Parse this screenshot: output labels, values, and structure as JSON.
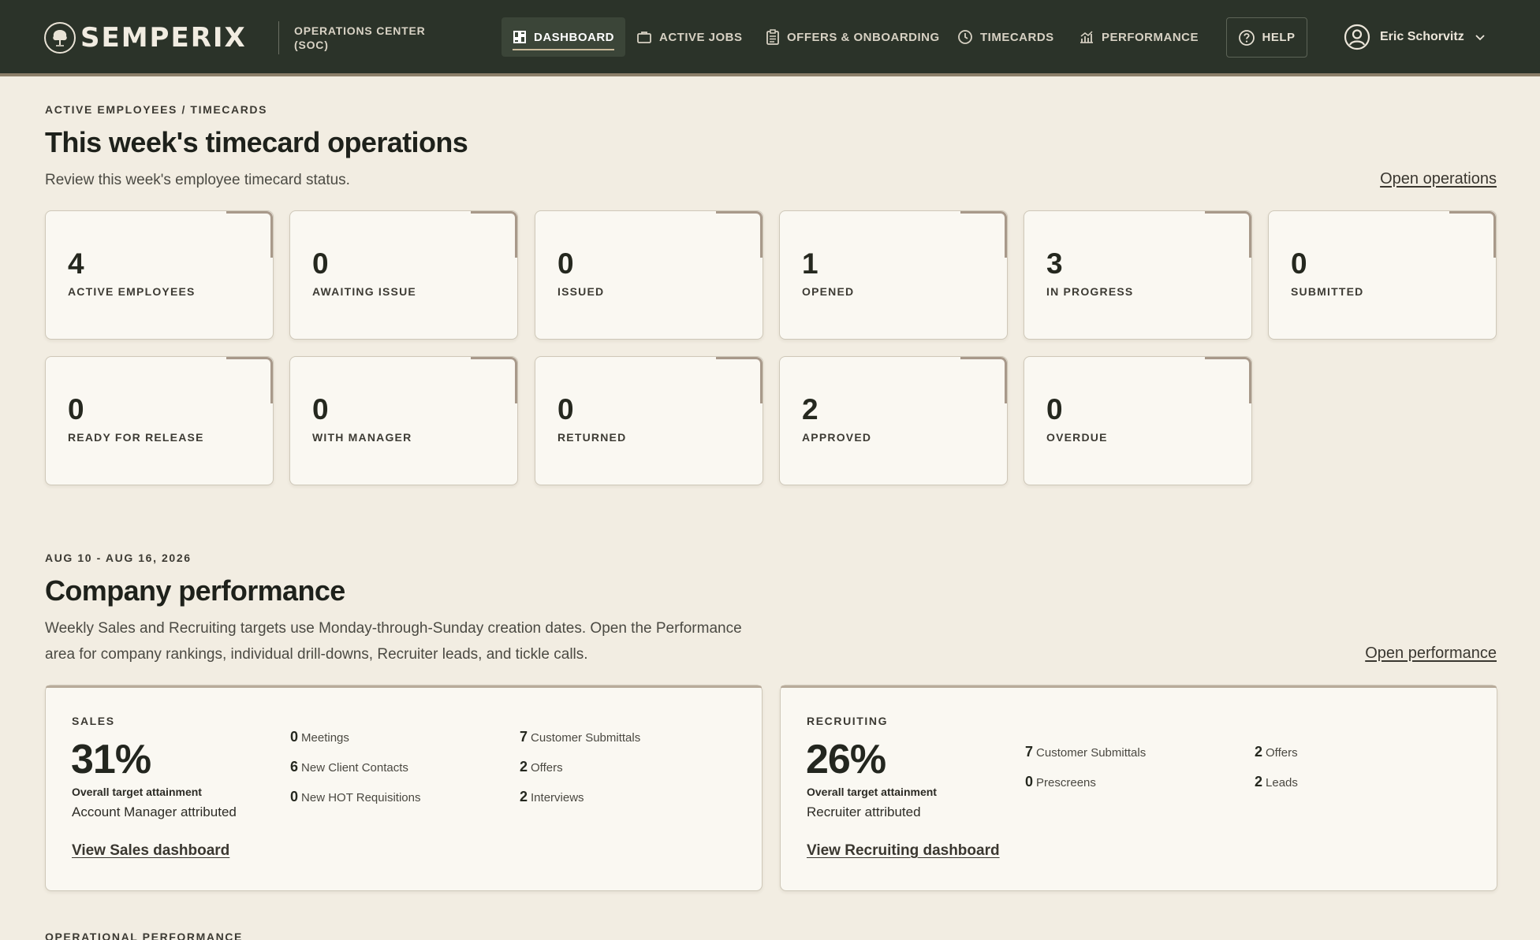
{
  "brand": {
    "name": "SEMPERIX",
    "subtitle": "OPERATIONS CENTER (SOC)",
    "logo_icon": "tree-seal-icon"
  },
  "nav": {
    "items": [
      {
        "label": "DASHBOARD",
        "icon": "grid-icon",
        "active": true
      },
      {
        "label": "ACTIVE JOBS",
        "icon": "briefcase-icon",
        "active": false
      },
      {
        "label": "OFFERS & ONBOARDING",
        "icon": "clipboard-icon",
        "active": false
      },
      {
        "label": "TIMECARDS",
        "icon": "clock-icon",
        "active": false
      },
      {
        "label": "PERFORMANCE",
        "icon": "chart-icon",
        "active": false
      }
    ],
    "help_label": "HELP",
    "user_name": "Eric Schorvitz"
  },
  "timecards": {
    "eyebrow": "ACTIVE EMPLOYEES / TIMECARDS",
    "title": "This week's timecard operations",
    "description": "Review this week's employee timecard status.",
    "link": "Open operations",
    "stats": [
      {
        "value": "4",
        "label": "ACTIVE EMPLOYEES"
      },
      {
        "value": "0",
        "label": "AWAITING ISSUE"
      },
      {
        "value": "0",
        "label": "ISSUED"
      },
      {
        "value": "1",
        "label": "OPENED"
      },
      {
        "value": "3",
        "label": "IN PROGRESS"
      },
      {
        "value": "0",
        "label": "SUBMITTED"
      },
      {
        "value": "0",
        "label": "READY FOR RELEASE"
      },
      {
        "value": "0",
        "label": "WITH MANAGER"
      },
      {
        "value": "0",
        "label": "RETURNED"
      },
      {
        "value": "2",
        "label": "APPROVED"
      },
      {
        "value": "0",
        "label": "OVERDUE"
      }
    ]
  },
  "performance": {
    "eyebrow": "AUG 10 - AUG 16, 2026",
    "title": "Company performance",
    "description_line1": "Weekly Sales and Recruiting targets use Monday-through-Sunday creation dates. Open the Performance",
    "description_line2": "area for company rankings, individual drill-downs, Recruiter leads, and tickle calls.",
    "link": "Open performance",
    "sales": {
      "eyebrow": "SALES",
      "pct": "31%",
      "pct_label": "Overall target attainment",
      "attribution": "Account Manager attributed",
      "metrics": [
        {
          "num": "0",
          "label": "Meetings"
        },
        {
          "num": "6",
          "label": "New Client Contacts"
        },
        {
          "num": "0",
          "label": "New HOT Requisitions"
        },
        {
          "num": "7",
          "label": "Customer Submittals"
        },
        {
          "num": "2",
          "label": "Offers"
        },
        {
          "num": "2",
          "label": "Interviews"
        }
      ],
      "link": "View Sales dashboard"
    },
    "recruiting": {
      "eyebrow": "RECRUITING",
      "pct": "26%",
      "pct_label": "Overall target attainment",
      "attribution": "Recruiter attributed",
      "metrics": [
        {
          "num": "7",
          "label": "Customer Submittals"
        },
        {
          "num": "0",
          "label": "Prescreens"
        },
        {
          "num": "2",
          "label": "Offers"
        },
        {
          "num": "2",
          "label": "Leads"
        }
      ],
      "link": "View Recruiting dashboard"
    }
  },
  "operational": {
    "eyebrow": "OPERATIONAL PERFORMANCE"
  }
}
